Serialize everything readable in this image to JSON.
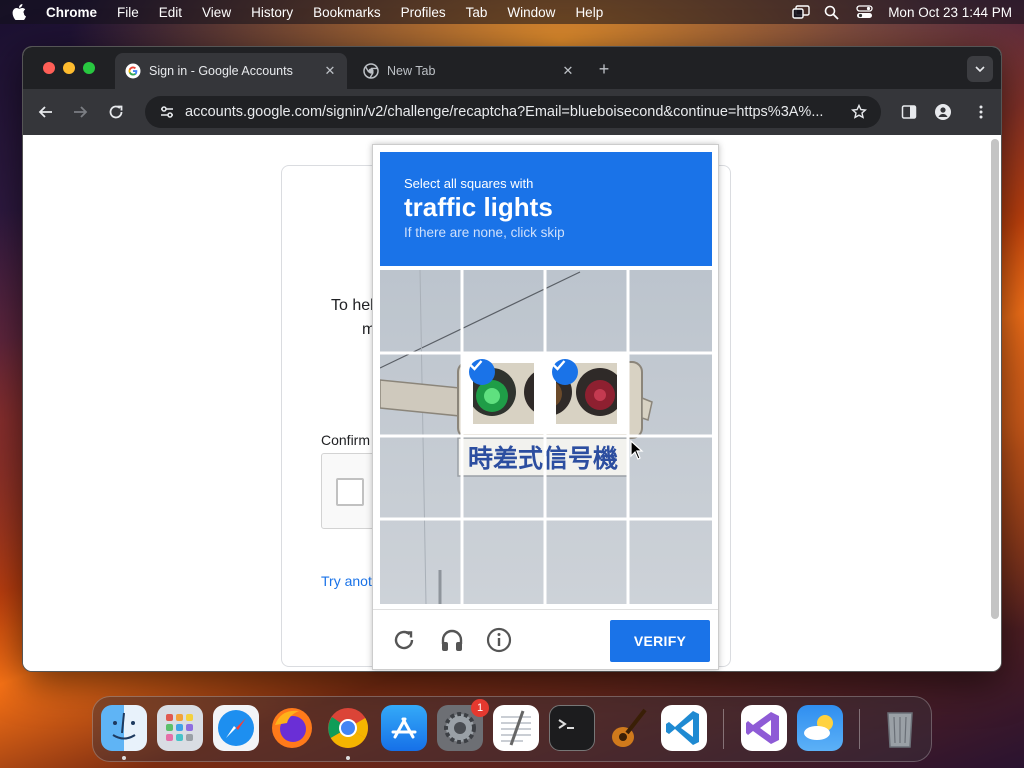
{
  "menubar": {
    "app": "Chrome",
    "items": [
      "File",
      "Edit",
      "View",
      "History",
      "Bookmarks",
      "Profiles",
      "Tab",
      "Window",
      "Help"
    ],
    "clock": "Mon Oct 23  1:44 PM"
  },
  "tabs": [
    {
      "title": "Sign in - Google Accounts",
      "active": true
    },
    {
      "title": "New Tab",
      "active": false
    }
  ],
  "omnibox": {
    "url": "accounts.google.com/signin/v2/challenge/recaptcha?Email=blueboisecond&continue=https%3A%..."
  },
  "background_page": {
    "partial_line_1": "To hel",
    "partial_line_2": "m",
    "confirm_label": "Confirm",
    "try_another": "Try anot"
  },
  "recaptcha": {
    "instruction": "Select all squares with",
    "target": "traffic lights",
    "hint": "If there are none, click skip",
    "image_sign_text": "時差式信号機",
    "verify_label": "VERIFY",
    "selected_cells": [
      [
        1,
        1
      ],
      [
        1,
        2
      ]
    ]
  },
  "dock": {
    "items": [
      "finder-icon",
      "launchpad-icon",
      "safari-icon",
      "firefox-icon",
      "chrome-icon",
      "app-store-icon",
      "system-settings-icon",
      "textedit-icon",
      "terminal-icon",
      "garageband-icon",
      "vscode-icon",
      "visual-studio-icon",
      "weather-icon",
      "trash-icon"
    ],
    "settings_badge": "1"
  },
  "colors": {
    "accent": "#1a73e8",
    "tabbar": "#202124",
    "toolbar": "#35363a"
  }
}
